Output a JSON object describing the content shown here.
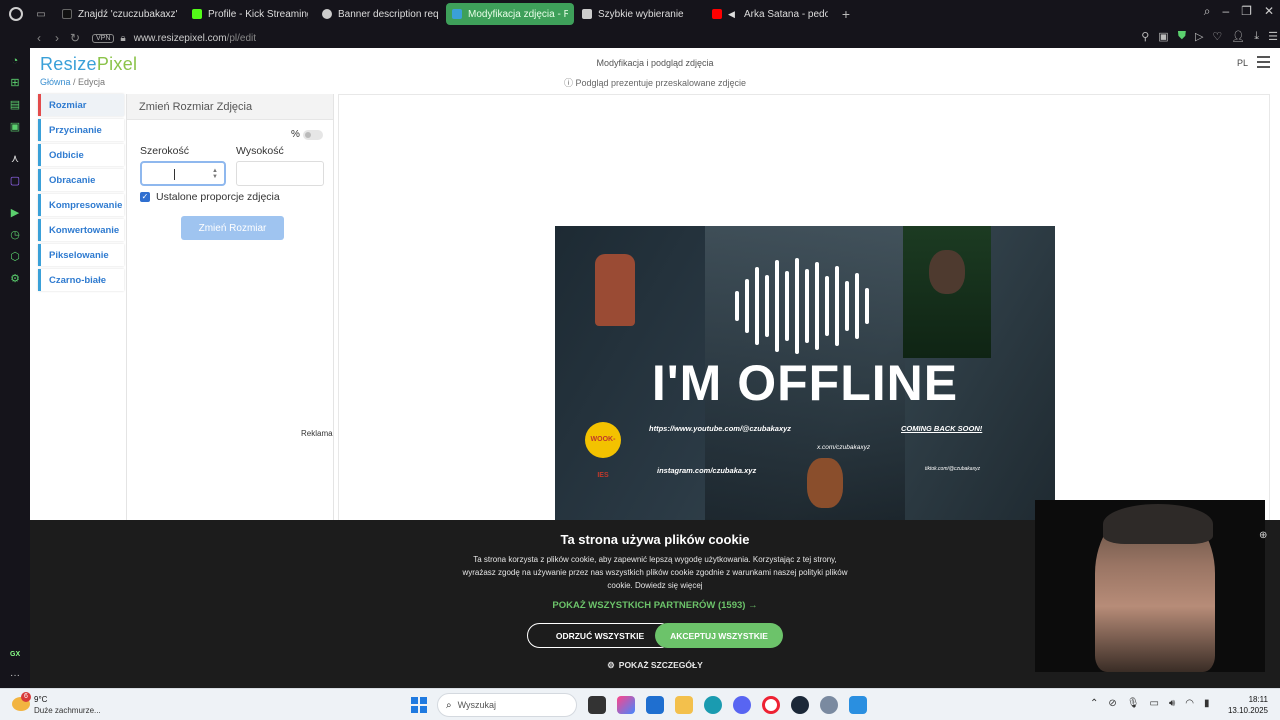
{
  "browser": {
    "tabs": [
      {
        "label": "Znajdź 'czuczubakaxz' na",
        "favicon_color": "#111111",
        "active": false
      },
      {
        "label": "Profile - Kick Streaming",
        "favicon_color": "#53fc18",
        "active": false
      },
      {
        "label": "Banner description reque",
        "favicon_color": "#cccccc",
        "active": false
      },
      {
        "label": "Modyfikacja zdjęcia - Res",
        "favicon_color": "#3aa0d8",
        "active": true
      },
      {
        "label": "Szybkie wybieranie",
        "favicon_color": "#cccccc",
        "active": false
      },
      {
        "label": "Arka Satana - pedofel",
        "favicon_color": "#ff0000",
        "active": false
      }
    ],
    "vpn_label": "VPN",
    "url_host": "www.resizepixel.com",
    "url_path": "/pl/edit",
    "accent_color": "#3ea05a"
  },
  "site": {
    "logo_part1": "Resize",
    "logo_part2": "Pixel",
    "breadcrumb_home": "Główna",
    "breadcrumb_sep": " / ",
    "breadcrumb_current": "Edycja",
    "header_title": "Modyfikacja i podgląd zdjęcia",
    "header_note": "ⓘ Podgląd prezentuje przeskalowane zdjęcie",
    "lang": "PL"
  },
  "menu": [
    {
      "label": "Rozmiar",
      "active": true
    },
    {
      "label": "Przycinanie"
    },
    {
      "label": "Odbicie"
    },
    {
      "label": "Obracanie"
    },
    {
      "label": "Kompresowanie"
    },
    {
      "label": "Konwertowanie"
    },
    {
      "label": "Pikselowanie"
    },
    {
      "label": "Czarno-białe"
    }
  ],
  "panel": {
    "title": "Zmień Rozmiar Zdjęcia",
    "percent_label": "%",
    "width_label": "Szerokość",
    "height_label": "Wysokość",
    "width_value": "",
    "height_value": "",
    "keep_ratio_label": "Ustalone proporcje zdjęcia",
    "keep_ratio_checked": true,
    "resize_button": "Zmień Rozmiar",
    "ad_label": "Reklama"
  },
  "preview_image": {
    "headline": "I'M OFFLINE",
    "youtube": "https://www.youtube.com/@czubakaxyz",
    "coming_soon": "COMING BACK SOON!",
    "x_handle": "x.com/czubakaxyz",
    "instagram": "instagram.com/czubaka.xyz",
    "tiktok": "tiktok.com/@czubakaxyz",
    "badge_text": "WOOK-IES"
  },
  "cookie": {
    "title": "Ta strona używa plików cookie",
    "body": "Ta strona korzysta z plików cookie, aby zapewnić lepszą wygodę użytkowania. Korzystając z tej strony, wyrażasz zgodę na używanie przez nas wszystkich plików cookie zgodnie z warunkami naszej polityki plików cookie. Dowiedz się więcej",
    "partners": "POKAŻ WSZYSTKICH PARTNERÓW (1593) →",
    "reject": "ODRZUĆ WSZYSTKIE",
    "accept": "AKCEPTUJ WSZYSTKIE",
    "details": "POKAŻ SZCZEGÓŁY",
    "accent_color": "#6cc36a"
  },
  "sidebar": {
    "gx_label": "GX",
    "more_label": "···"
  },
  "taskbar": {
    "weather_badge": "6",
    "temperature": "9°C",
    "weather_desc": "Duże zachmurze...",
    "search_placeholder": "Wyszukaj",
    "time": "18:11",
    "date": "13.10.2025"
  }
}
